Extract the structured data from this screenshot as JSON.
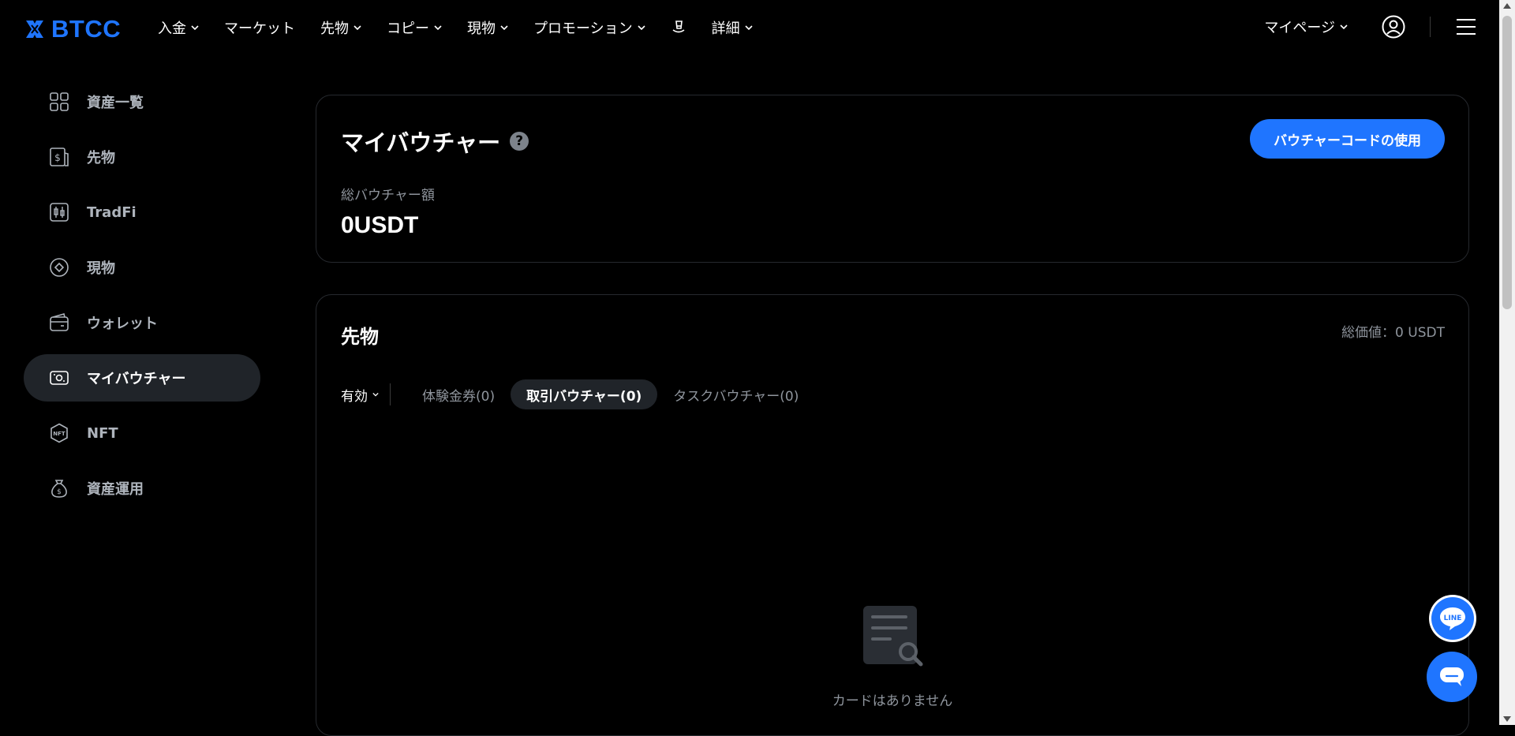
{
  "brand": {
    "name": "BTCC",
    "accent": "#1f75ff"
  },
  "nav": {
    "items": [
      {
        "label": "入金",
        "dropdown": true
      },
      {
        "label": "マーケット",
        "dropdown": false
      },
      {
        "label": "先物",
        "dropdown": true
      },
      {
        "label": "コピー",
        "dropdown": true
      },
      {
        "label": "現物",
        "dropdown": true
      },
      {
        "label": "プロモーション",
        "dropdown": true
      },
      {
        "label": "",
        "icon": "hat-icon"
      },
      {
        "label": "詳細",
        "dropdown": true
      }
    ],
    "mypage_label": "マイページ"
  },
  "sidebar": {
    "items": [
      {
        "label": "資産一覧",
        "icon": "grid-icon"
      },
      {
        "label": "先物",
        "icon": "futures-icon"
      },
      {
        "label": "TradFi",
        "icon": "candles-icon"
      },
      {
        "label": "現物",
        "icon": "spot-icon"
      },
      {
        "label": "ウォレット",
        "icon": "wallet-icon"
      },
      {
        "label": "マイバウチャー",
        "icon": "voucher-icon",
        "active": true
      },
      {
        "label": "NFT",
        "icon": "nft-icon"
      },
      {
        "label": "資産運用",
        "icon": "moneybag-icon"
      }
    ]
  },
  "voucher_card": {
    "title": "マイバウチャー",
    "help_glyph": "?",
    "use_button_label": "バウチャーコードの使用",
    "total_label": "総バウチャー額",
    "total_value": "0USDT"
  },
  "futures_section": {
    "title": "先物",
    "total_value": "総価値：0 USDT",
    "status_filter": "有効",
    "tabs": [
      {
        "label": "体験金券(0)",
        "active": false
      },
      {
        "label": "取引バウチャー(0)",
        "active": true
      },
      {
        "label": "タスクバウチャー(0)",
        "active": false
      }
    ],
    "empty_text": "カードはありません"
  },
  "fab": {
    "line_label": "LINE"
  }
}
